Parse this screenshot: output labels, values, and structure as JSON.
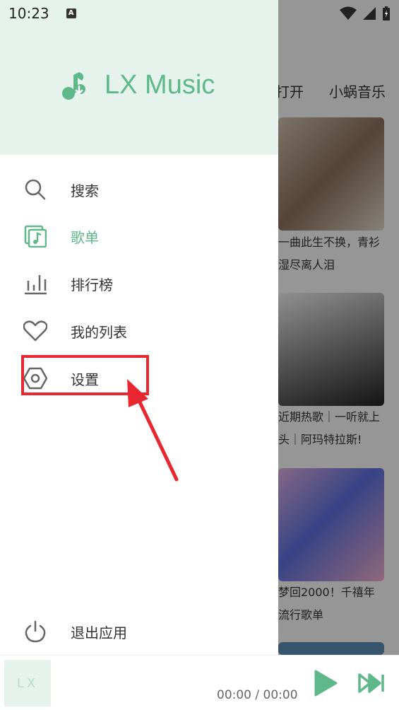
{
  "status_bar": {
    "time": "10:23",
    "notification_icon": "A"
  },
  "drawer": {
    "app_name": "LX Music",
    "menu": [
      {
        "label": "搜索",
        "icon": "search-icon"
      },
      {
        "label": "歌单",
        "icon": "songlist-icon",
        "active": true
      },
      {
        "label": "排行榜",
        "icon": "chart-icon"
      },
      {
        "label": "我的列表",
        "icon": "heart-icon"
      },
      {
        "label": "设置",
        "icon": "settings-icon"
      }
    ],
    "exit_label": "退出应用"
  },
  "background": {
    "tabs": [
      "打开",
      "小蜗音乐"
    ],
    "cards": [
      {
        "title": "一曲此生不换，青衫\n湿尽离人泪"
      },
      {
        "title": "近期热歌｜一听就上\n头｜阿玛特拉斯!"
      },
      {
        "title": "梦回2000！千禧年\n流行歌单"
      }
    ]
  },
  "player": {
    "cover_text": "LX",
    "time": "00:00 / 00:00"
  },
  "colors": {
    "accent": "#5fb88a",
    "header_bg": "#e6f3ec",
    "annotation": "#e82731"
  }
}
